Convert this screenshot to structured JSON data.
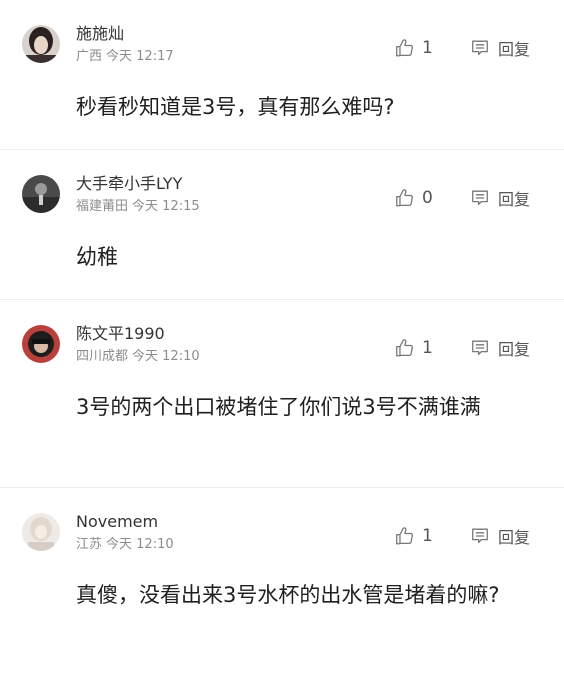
{
  "comments": [
    {
      "username": "施施灿",
      "location": "广西",
      "time": "今天 12:17",
      "likes": "1",
      "reply_label": "回复",
      "text": "秒看秒知道是3号，真有那么难吗?"
    },
    {
      "username": "大手牵小手LYY",
      "location": "福建莆田",
      "time": "今天 12:15",
      "likes": "0",
      "reply_label": "回复",
      "text": "幼稚"
    },
    {
      "username": "陈文平1990",
      "location": "四川成都",
      "time": "今天 12:10",
      "likes": "1",
      "reply_label": "回复",
      "text": "3号的两个出口被堵住了你们说3号不满谁满"
    },
    {
      "username": "Novemem",
      "location": "江苏",
      "time": "今天 12:10",
      "likes": "1",
      "reply_label": "回复",
      "text": "真傻，没看出来3号水杯的出水管是堵着的嘛?"
    }
  ],
  "icons": {
    "like": "thumbs-up-icon",
    "reply": "comment-icon"
  },
  "colors": {
    "text": "#1f1f1f",
    "meta": "#8c8c8c",
    "icon": "#777777",
    "divider": "#ececec"
  }
}
